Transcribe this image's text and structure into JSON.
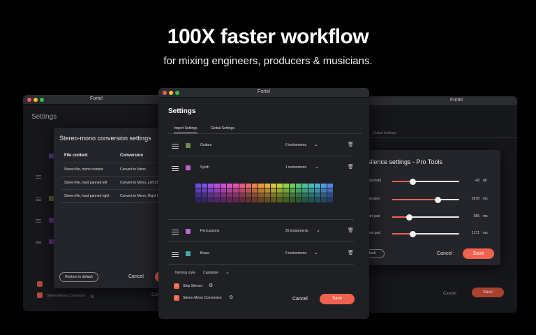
{
  "hero": {
    "title": "100X faster workflow",
    "subtitle": "for mixing engineers, producers & musicians."
  },
  "colors": {
    "accent": "#f0624d",
    "window_bg": "#1f2024",
    "modal_bg": "#24252a"
  },
  "left_window": {
    "app_title": "Fortel",
    "heading": "Settings",
    "modal": {
      "title": "Stereo-mono conversion settings",
      "columns": [
        "File content",
        "Conversion"
      ],
      "rows": [
        [
          "Stereo file, mono content",
          "Convert to Mono"
        ],
        [
          "Stereo file, hard panned left",
          "Convert to Mono, Left Channel"
        ],
        [
          "Stereo file, hard panned right",
          "Convert to Mono, Right Channel"
        ]
      ],
      "restore_label": "Restore to default",
      "cancel_label": "Cancel"
    },
    "background_checkbox_label": "Stereo-Mono Conversion",
    "background_cancel_label": "Cancel"
  },
  "right_window": {
    "app_title": "Fortel",
    "tab_global": "Global Settings",
    "modal": {
      "title": "silence settings - Pro Tools",
      "sliders": [
        {
          "label": "hreshold",
          "value": "-48",
          "unit": "db",
          "fraction": 0.3
        },
        {
          "label": "duration",
          "value": "2678",
          "unit": "ms",
          "fraction": 0.68
        },
        {
          "label": "tart pad",
          "value": "586",
          "unit": "ms",
          "fraction": 0.25
        },
        {
          "label": "end pad",
          "value": "1171",
          "unit": "ms",
          "fraction": 0.3
        }
      ],
      "default_label": "efault",
      "cancel_label": "Cancel",
      "save_label": "Save"
    },
    "background_cancel_label": "Cancel",
    "background_save_label": "Save"
  },
  "center_window": {
    "app_title": "Fortel",
    "heading": "Settings",
    "tabs": [
      {
        "label": "Import Settings",
        "active": true
      },
      {
        "label": "Global Settings",
        "active": false
      }
    ],
    "instruments": [
      {
        "name": "Guitars",
        "count": "6 instruments",
        "color": "#6e8c4a"
      },
      {
        "name": "Synth",
        "count": "1 instruments",
        "color": "#c85ad2"
      },
      {
        "name": "Percussions",
        "count": "25 instruments",
        "color": "#b66bd6"
      },
      {
        "name": "Brass",
        "count": "6 instruments",
        "color": "#4aa6a8"
      }
    ],
    "palette": [
      "#6c4de0",
      "#7c4fe6",
      "#9a52e6",
      "#b552e2",
      "#cc52d6",
      "#dc52c2",
      "#e254a6",
      "#e65a86",
      "#e66a66",
      "#e8824e",
      "#e89a44",
      "#e4b040",
      "#d8c63c",
      "#bcd040",
      "#94d04a",
      "#6ecc58",
      "#54c874",
      "#4cc298",
      "#48bcba",
      "#48b2d0",
      "#4c9ee0",
      "#5484e4"
    ],
    "naming_style_label": "Naming style",
    "naming_style_value": "Capitalize",
    "checkboxes": [
      {
        "label": "Strip Silence",
        "checked": true
      },
      {
        "label": "Stereo-Mono Conversion",
        "checked": true
      }
    ],
    "cancel_label": "Cancel",
    "save_label": "Save"
  }
}
